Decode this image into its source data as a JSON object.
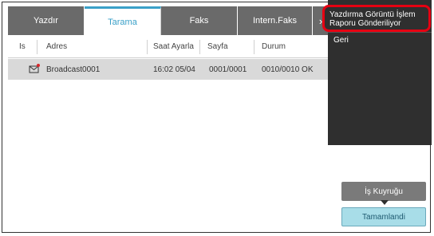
{
  "tabs": [
    {
      "label": "Yazdır"
    },
    {
      "label": "Tarama"
    },
    {
      "label": "Faks"
    },
    {
      "label": "Intern.Faks"
    }
  ],
  "table": {
    "headers": {
      "is": "Is",
      "adres": "Adres",
      "saat": "Saat Ayarla",
      "sayfa": "Sayfa",
      "durum": "Durum"
    },
    "rows": [
      {
        "adres": "Broadcast0001",
        "saat": "16:02 05/04",
        "sayfa": "0001/0001",
        "durum": "0010/0010 OK"
      }
    ]
  },
  "side_menu": {
    "item1": "Yazdırma Görüntü İşlem Raporu Gönderiliyor",
    "item2": "Geri"
  },
  "buttons": {
    "queue": "İş Kuyruğu",
    "done": "Tamamlandi"
  }
}
